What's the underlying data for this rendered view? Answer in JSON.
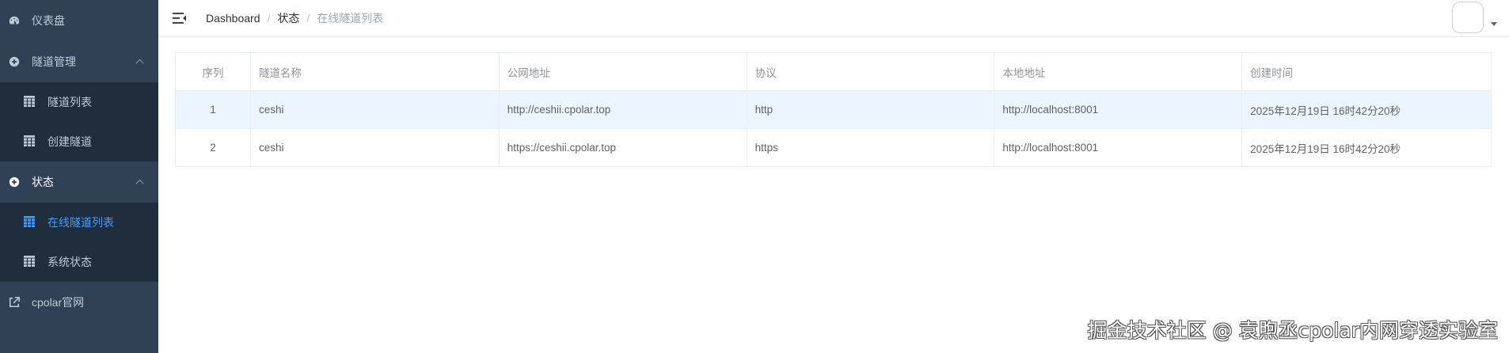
{
  "sidebar": {
    "dashboard_label": "仪表盘",
    "tunnel_mgmt_label": "隧道管理",
    "tunnel_list_label": "隧道列表",
    "create_tunnel_label": "创建隧道",
    "status_label": "状态",
    "online_tunnels_label": "在线隧道列表",
    "system_status_label": "系统状态",
    "cpolar_site_label": "cpolar官网"
  },
  "navbar": {
    "breadcrumb": [
      "Dashboard",
      "状态",
      "在线隧道列表"
    ]
  },
  "table": {
    "headers": [
      "序列",
      "隧道名称",
      "公网地址",
      "协议",
      "本地地址",
      "创建时间"
    ],
    "rows": [
      [
        "1",
        "ceshi",
        "http://ceshii.cpolar.top",
        "http",
        "http://localhost:8001",
        "2025年12月19日 16时42分20秒"
      ],
      [
        "2",
        "ceshi",
        "https://ceshii.cpolar.top",
        "https",
        "http://localhost:8001",
        "2025年12月19日 16时42分20秒"
      ]
    ]
  },
  "watermark": "掘金技术社区 @ 袁煦丞cpolar内网穿透实验室",
  "colors": {
    "sidebar_bg": "#304156",
    "submenu_bg": "#1f2d3d",
    "active": "#409eff",
    "row_highlight": "#ecf5ff"
  }
}
